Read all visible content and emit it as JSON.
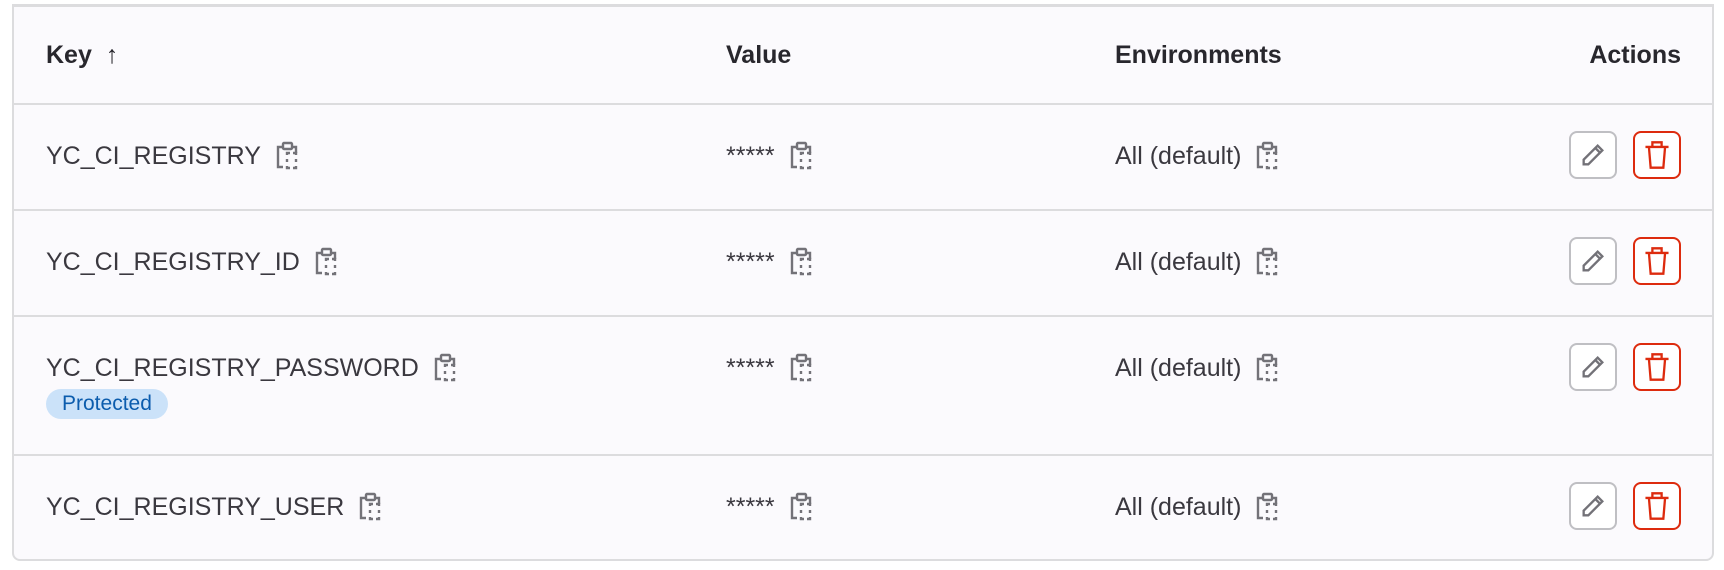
{
  "headers": {
    "key": "Key",
    "sort_icon": "↑",
    "value": "Value",
    "environments": "Environments",
    "actions": "Actions"
  },
  "rows": [
    {
      "key": "YC_CI_REGISTRY",
      "value": "*****",
      "environment": "All (default)"
    },
    {
      "key": "YC_CI_REGISTRY_ID",
      "value": "*****",
      "environment": "All (default)"
    },
    {
      "key": "YC_CI_REGISTRY_PASSWORD",
      "value": "*****",
      "environment": "All (default)",
      "badge": "Protected"
    },
    {
      "key": "YC_CI_REGISTRY_USER",
      "value": "*****",
      "environment": "All (default)"
    }
  ],
  "colors": {
    "danger": "#dd2b0e",
    "badge_bg": "#cbe2f9",
    "badge_text": "#0b5cad"
  }
}
